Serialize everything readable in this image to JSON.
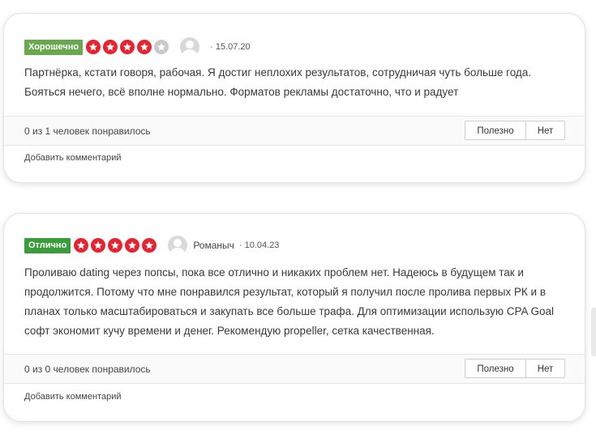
{
  "colors": {
    "good": "#6aa84f",
    "excellent": "#3a9c3a",
    "star_on": "#e8222f",
    "star_off": "#c9c9c9"
  },
  "reviews": [
    {
      "badge": "Хорошечно",
      "rating": 4,
      "rating_max": 5,
      "author": "",
      "date": "· 15.07.20",
      "text": "Партнёрка, кстати говоря, рабочая. Я достиг неплохих результатов, сотрудничая чуть больше года. Бояться нечего, всё вполне нормально. Форматов рекламы достаточно, что и радует",
      "votes": "0 из 1 человек понравилось",
      "yes_label": "Полезно",
      "no_label": "Нет",
      "add_comment": "Добавить комментарий"
    },
    {
      "badge": "Отлично",
      "rating": 5,
      "rating_max": 5,
      "author": "Романыч",
      "date": "· 10.04.23",
      "text": "Проливаю dating через попсы, пока все отлично и никаких проблем нет. Надеюсь в будущем так и продолжится. Потому что мне понравился результат, который я получил после пролива первых РК и в планах только масштабироваться и закупать все больше трафа. Для оптимизации использую CPA Goal софт экономит кучу времени и денег. Рекомендую propeller, сетка качественная.",
      "votes": "0 из 0 человек понравилось",
      "yes_label": "Полезно",
      "no_label": "Нет",
      "add_comment": "Добавить комментарий"
    }
  ]
}
